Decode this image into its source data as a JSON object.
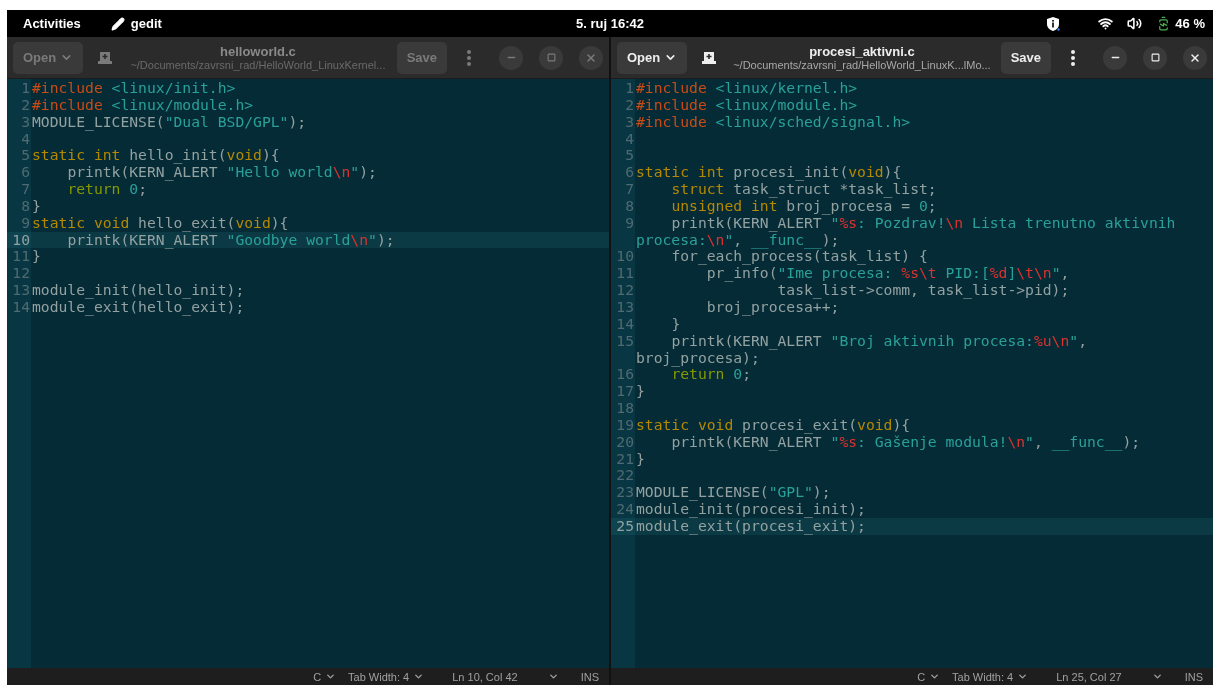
{
  "top_bar": {
    "activities": "Activities",
    "app_name": "gedit",
    "clock": "5. ruj 16:42",
    "battery": "46 %"
  },
  "windows": [
    {
      "active": false,
      "open_label": "Open",
      "title": "helloworld.c",
      "subtitle": "~/Documents/zavrsni_rad/HelloWorld_LinuxKernel...",
      "save_label": "Save",
      "lines": [
        {
          "number": "1",
          "current": false,
          "tokens": [
            {
              "kind": "pre",
              "text": "#include "
            },
            {
              "kind": "path",
              "text": "<linux/init.h>"
            }
          ]
        },
        {
          "number": "2",
          "current": false,
          "tokens": [
            {
              "kind": "pre",
              "text": "#include "
            },
            {
              "kind": "path",
              "text": "<linux/module.h>"
            }
          ]
        },
        {
          "number": "3",
          "current": false,
          "tokens": [
            {
              "kind": "plain",
              "text": "MODULE_LICENSE("
            },
            {
              "kind": "str",
              "text": "\"Dual BSD/GPL\""
            },
            {
              "kind": "plain",
              "text": ");"
            }
          ]
        },
        {
          "number": "4",
          "current": false
        },
        {
          "number": "5",
          "current": false,
          "tokens": [
            {
              "kind": "type",
              "text": "static "
            },
            {
              "kind": "type",
              "text": "int"
            },
            {
              "kind": "plain",
              "text": " hello_init("
            },
            {
              "kind": "type",
              "text": "void"
            },
            {
              "kind": "plain",
              "text": "){"
            }
          ]
        },
        {
          "number": "6",
          "current": false,
          "tokens": [
            {
              "kind": "plain",
              "text": "    printk(KERN_ALERT "
            },
            {
              "kind": "str",
              "text": "\"Hello world"
            },
            {
              "kind": "esc",
              "text": "\\n"
            },
            {
              "kind": "str",
              "text": "\""
            },
            {
              "kind": "plain",
              "text": ");"
            }
          ]
        },
        {
          "number": "7",
          "current": false,
          "tokens": [
            {
              "kind": "kw",
              "text": "    return"
            },
            {
              "kind": "num",
              "text": " 0"
            },
            {
              "kind": "plain",
              "text": ";"
            }
          ]
        },
        {
          "number": "8",
          "current": false,
          "tokens": [
            {
              "kind": "plain",
              "text": "}"
            }
          ]
        },
        {
          "number": "9",
          "current": false,
          "tokens": [
            {
              "kind": "type",
              "text": "static "
            },
            {
              "kind": "type",
              "text": "void"
            },
            {
              "kind": "plain",
              "text": " hello_exit("
            },
            {
              "kind": "type",
              "text": "void"
            },
            {
              "kind": "plain",
              "text": "){"
            }
          ]
        },
        {
          "number": "10",
          "current": true,
          "tokens": [
            {
              "kind": "plain",
              "text": "    printk(KERN_ALERT "
            },
            {
              "kind": "str",
              "text": "\"Goodbye world"
            },
            {
              "kind": "esc",
              "text": "\\n"
            },
            {
              "kind": "str",
              "text": "\""
            },
            {
              "kind": "plain",
              "text": ");"
            }
          ]
        },
        {
          "number": "11",
          "current": false,
          "tokens": [
            {
              "kind": "plain",
              "text": "}"
            }
          ]
        },
        {
          "number": "12",
          "current": false
        },
        {
          "number": "13",
          "current": false,
          "tokens": [
            {
              "kind": "plain",
              "text": "module_init(hello_init);"
            }
          ]
        },
        {
          "number": "14",
          "current": false,
          "tokens": [
            {
              "kind": "plain",
              "text": "module_exit(hello_exit);"
            }
          ]
        }
      ],
      "status": {
        "language": "C",
        "tab_width": "Tab Width: 4",
        "position": "Ln 10, Col 42",
        "mode": "INS"
      }
    },
    {
      "active": true,
      "open_label": "Open",
      "title": "procesi_aktivni.c",
      "subtitle": "~/Documents/zavrsni_rad/HelloWorld_LinuxK...lMo...",
      "save_label": "Save",
      "lines": [
        {
          "number": "1",
          "current": false,
          "tokens": [
            {
              "kind": "pre",
              "text": "#include "
            },
            {
              "kind": "path",
              "text": "<linux/kernel.h>"
            }
          ]
        },
        {
          "number": "2",
          "current": false,
          "tokens": [
            {
              "kind": "pre",
              "text": "#include "
            },
            {
              "kind": "path",
              "text": "<linux/module.h>"
            }
          ]
        },
        {
          "number": "3",
          "current": false,
          "tokens": [
            {
              "kind": "pre",
              "text": "#include "
            },
            {
              "kind": "path",
              "text": "<linux/sched/signal.h>"
            }
          ]
        },
        {
          "number": "4",
          "current": false
        },
        {
          "number": "5",
          "current": false
        },
        {
          "number": "6",
          "current": false,
          "tokens": [
            {
              "kind": "type",
              "text": "static "
            },
            {
              "kind": "type",
              "text": "int"
            },
            {
              "kind": "plain",
              "text": " procesi_init("
            },
            {
              "kind": "type",
              "text": "void"
            },
            {
              "kind": "plain",
              "text": "){"
            }
          ]
        },
        {
          "number": "7",
          "current": false,
          "tokens": [
            {
              "kind": "type",
              "text": "    struct"
            },
            {
              "kind": "plain",
              "text": " task_struct *task_list;"
            }
          ]
        },
        {
          "number": "8",
          "current": false,
          "tokens": [
            {
              "kind": "type",
              "text": "    unsigned "
            },
            {
              "kind": "type",
              "text": "int"
            },
            {
              "kind": "plain",
              "text": " broj_procesa = "
            },
            {
              "kind": "num",
              "text": "0"
            },
            {
              "kind": "plain",
              "text": ";"
            }
          ]
        },
        {
          "number": "9",
          "current": false,
          "tokens": [
            {
              "kind": "plain",
              "text": "    printk(KERN_ALERT "
            },
            {
              "kind": "str",
              "text": "\""
            },
            {
              "kind": "esc",
              "text": "%s"
            },
            {
              "kind": "str",
              "text": ": Pozdrav!"
            },
            {
              "kind": "esc",
              "text": "\\n"
            },
            {
              "kind": "str",
              "text": " Lista trenutno aktivnih procesa:"
            },
            {
              "kind": "esc",
              "text": "\\n"
            },
            {
              "kind": "str",
              "text": "\""
            },
            {
              "kind": "plain",
              "text": ", "
            },
            {
              "kind": "const",
              "text": "__func__"
            },
            {
              "kind": "plain",
              "text": ");"
            }
          ]
        },
        {
          "number": "10",
          "current": false,
          "tokens": [
            {
              "kind": "plain",
              "text": "    for_each_process(task_list) {"
            }
          ]
        },
        {
          "number": "11",
          "current": false,
          "tokens": [
            {
              "kind": "plain",
              "text": "        pr_info("
            },
            {
              "kind": "str",
              "text": "\"Ime procesa: "
            },
            {
              "kind": "esc",
              "text": "%s\\t"
            },
            {
              "kind": "str",
              "text": " PID:["
            },
            {
              "kind": "esc",
              "text": "%d"
            },
            {
              "kind": "str",
              "text": "]"
            },
            {
              "kind": "esc",
              "text": "\\t\\n"
            },
            {
              "kind": "str",
              "text": "\""
            },
            {
              "kind": "plain",
              "text": ","
            }
          ]
        },
        {
          "number": "12",
          "current": false,
          "tokens": [
            {
              "kind": "plain",
              "text": "                task_list->comm, task_list->pid);"
            }
          ]
        },
        {
          "number": "13",
          "current": false,
          "tokens": [
            {
              "kind": "plain",
              "text": "        broj_procesa++;"
            }
          ]
        },
        {
          "number": "14",
          "current": false,
          "tokens": [
            {
              "kind": "plain",
              "text": "    }"
            }
          ]
        },
        {
          "number": "15",
          "current": false,
          "tokens": [
            {
              "kind": "plain",
              "text": "    printk(KERN_ALERT "
            },
            {
              "kind": "str",
              "text": "\"Broj aktivnih procesa:"
            },
            {
              "kind": "esc",
              "text": "%u\\n"
            },
            {
              "kind": "str",
              "text": "\""
            },
            {
              "kind": "plain",
              "text": ", broj_procesa);"
            }
          ]
        },
        {
          "number": "16",
          "current": false,
          "tokens": [
            {
              "kind": "kw",
              "text": "    return"
            },
            {
              "kind": "num",
              "text": " 0"
            },
            {
              "kind": "plain",
              "text": ";"
            }
          ]
        },
        {
          "number": "17",
          "current": false,
          "tokens": [
            {
              "kind": "plain",
              "text": "}"
            }
          ]
        },
        {
          "number": "18",
          "current": false
        },
        {
          "number": "19",
          "current": false,
          "tokens": [
            {
              "kind": "type",
              "text": "static "
            },
            {
              "kind": "type",
              "text": "void"
            },
            {
              "kind": "plain",
              "text": " procesi_exit("
            },
            {
              "kind": "type",
              "text": "void"
            },
            {
              "kind": "plain",
              "text": "){"
            }
          ]
        },
        {
          "number": "20",
          "current": false,
          "tokens": [
            {
              "kind": "plain",
              "text": "    printk(KERN_ALERT "
            },
            {
              "kind": "str",
              "text": "\""
            },
            {
              "kind": "esc",
              "text": "%s"
            },
            {
              "kind": "str",
              "text": ": Gašenje modula!"
            },
            {
              "kind": "esc",
              "text": "\\n"
            },
            {
              "kind": "str",
              "text": "\""
            },
            {
              "kind": "plain",
              "text": ", "
            },
            {
              "kind": "const",
              "text": "__func__"
            },
            {
              "kind": "plain",
              "text": ");"
            }
          ]
        },
        {
          "number": "21",
          "current": false,
          "tokens": [
            {
              "kind": "plain",
              "text": "}"
            }
          ]
        },
        {
          "number": "22",
          "current": false
        },
        {
          "number": "23",
          "current": false,
          "tokens": [
            {
              "kind": "plain",
              "text": "MODULE_LICENSE("
            },
            {
              "kind": "str",
              "text": "\"GPL\""
            },
            {
              "kind": "plain",
              "text": ");"
            }
          ]
        },
        {
          "number": "24",
          "current": false,
          "tokens": [
            {
              "kind": "plain",
              "text": "module_init(procesi_init);"
            }
          ]
        },
        {
          "number": "25",
          "current": true,
          "tokens": [
            {
              "kind": "plain",
              "text": "module_exit(procesi_exit);"
            }
          ]
        }
      ],
      "status": {
        "language": "C",
        "tab_width": "Tab Width: 4",
        "position": "Ln 25, Col 27",
        "mode": "INS"
      }
    }
  ]
}
